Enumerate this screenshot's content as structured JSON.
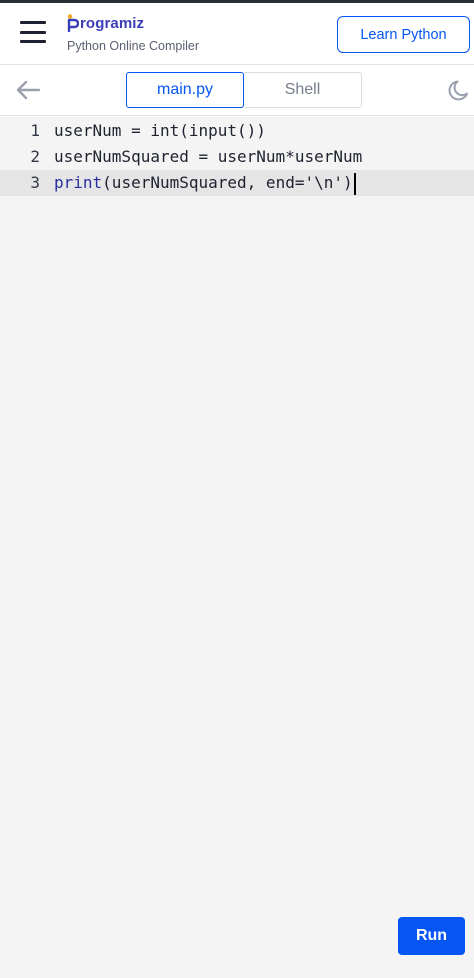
{
  "header": {
    "brand_name": "rogramiz",
    "subtitle": "Python Online Compiler",
    "learn_button": "Learn Python"
  },
  "tabs": [
    {
      "label": "main.py",
      "active": true
    },
    {
      "label": "Shell",
      "active": false
    }
  ],
  "editor": {
    "lines": [
      {
        "number": "1",
        "code": "userNum = int(input())"
      },
      {
        "number": "2",
        "code": "userNumSquared = userNum*userNum"
      },
      {
        "number": "3",
        "code_kw": "print",
        "code_rest": "(userNumSquared, end='\\n')"
      }
    ],
    "active_line": 3
  },
  "run_button": "Run",
  "colors": {
    "accent": "#0556f3",
    "brand": "#3b3fb7",
    "editor_bg": "#f4f4f4",
    "active_line_bg": "#e5e5e5"
  },
  "icons": [
    "menu-icon",
    "programiz-logo",
    "back-arrow-icon",
    "moon-icon"
  ]
}
